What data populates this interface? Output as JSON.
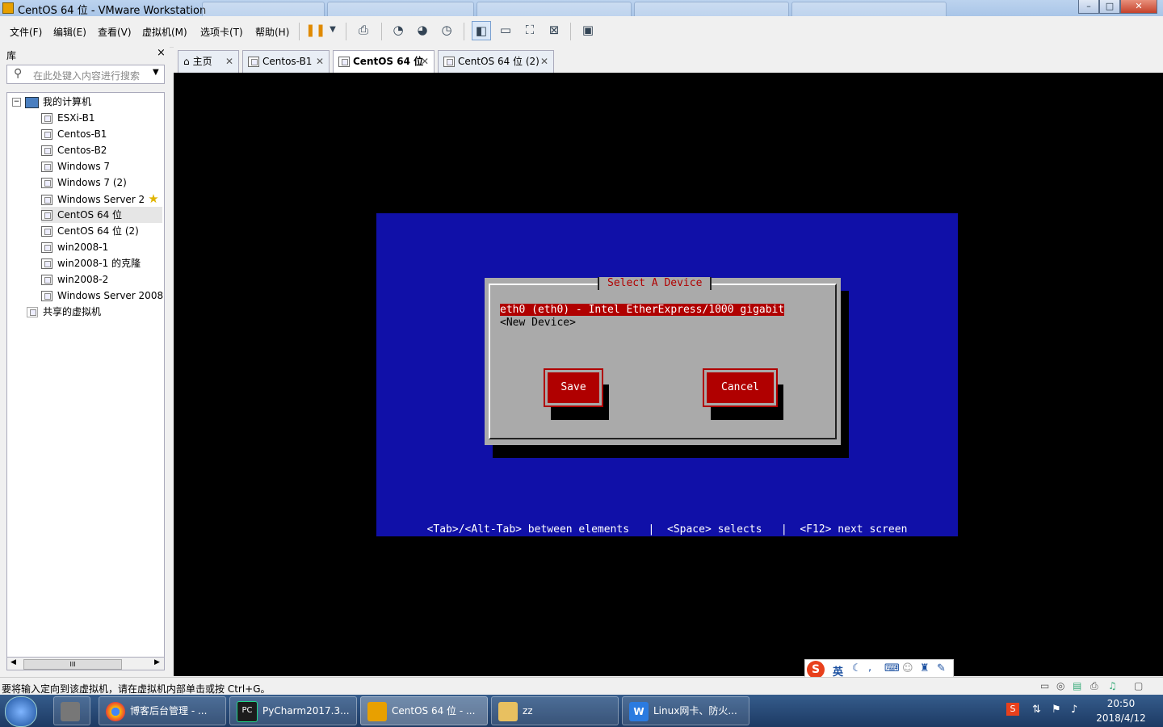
{
  "window": {
    "title": "CentOS 64 位 - VMware Workstation",
    "btn_min": "–",
    "btn_max": "□",
    "btn_close": "✕"
  },
  "menu": [
    "文件(F)",
    "编辑(E)",
    "查看(V)",
    "虚拟机(M)",
    "选项卡(T)",
    "帮助(H)"
  ],
  "library": {
    "title": "库",
    "close": "×",
    "search_placeholder": "在此处键入内容进行搜索",
    "root": "我的计算机",
    "items": [
      "ESXi-B1",
      "Centos-B1",
      "Centos-B2",
      "Windows 7",
      "Windows 7 (2)",
      "Windows Server 2",
      "CentOS 64 位",
      "CentOS 64 位 (2)",
      "win2008-1",
      "win2008-1 的克隆",
      "win2008-2",
      "Windows Server 2008"
    ],
    "shared": "共享的虚拟机",
    "scroll_mark": "III"
  },
  "tabs": [
    {
      "label": "主页"
    },
    {
      "label": "Centos-B1"
    },
    {
      "label": "CentOS 64 位"
    },
    {
      "label": "CentOS 64 位 (2)"
    }
  ],
  "tab_close": "✕",
  "vm_screen": {
    "dialog_title": "Select A Device",
    "devices": [
      "eth0 (eth0) - Intel EtherExpress/1000 gigabit",
      "<New Device>"
    ],
    "buttons": {
      "save": "Save",
      "cancel": "Cancel"
    },
    "help": "<Tab>/<Alt-Tab> between elements   |  <Space> selects   |  <F12> next screen"
  },
  "ime": {
    "label": "英"
  },
  "status_text": "要将输入定向到该虚拟机，请在虚拟机内部单击或按 Ctrl+G。",
  "taskbar": {
    "tasks": [
      "博客后台管理 - ...",
      "PyCharm2017.3...",
      "CentOS 64 位 - ...",
      "zz",
      "Linux网卡、防火..."
    ],
    "time": "20:50",
    "date": "2018/4/12"
  },
  "colors": {
    "vm_blue": "#1010a8",
    "dialog_gray": "#aaaaaa",
    "highlight_red": "#b00000"
  }
}
